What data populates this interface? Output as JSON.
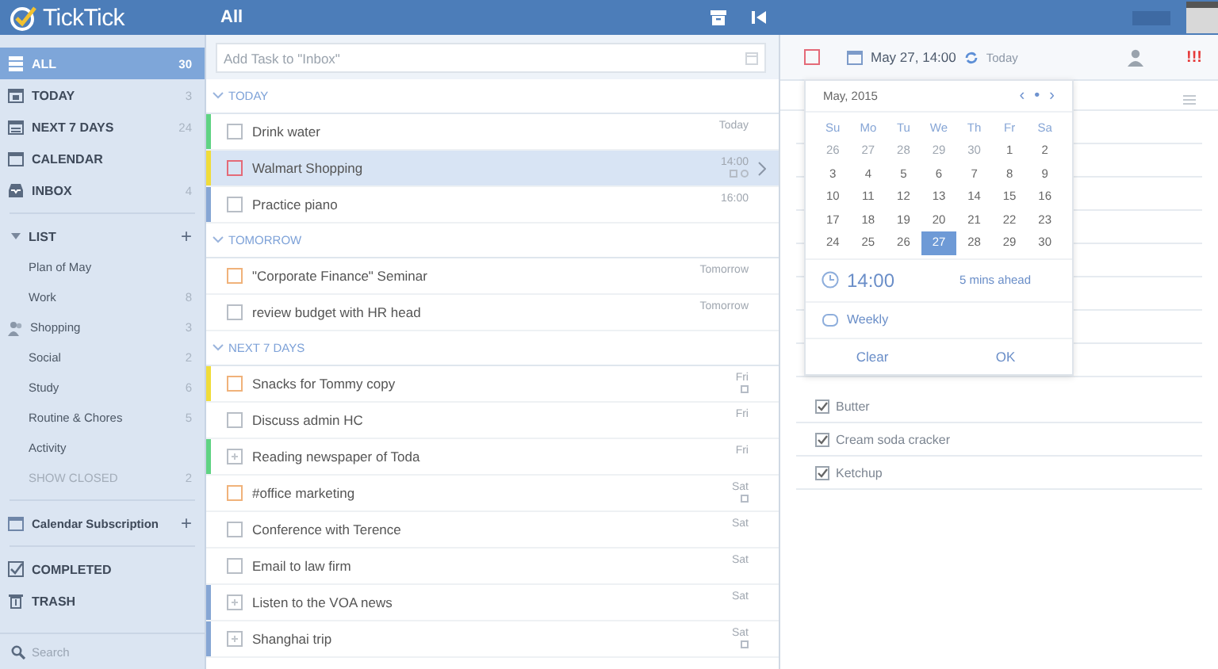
{
  "header": {
    "app_name": "TickTick",
    "title": "All"
  },
  "sidebar": {
    "smart_lists": [
      {
        "kind": "all",
        "label": "ALL",
        "count": "30",
        "selected": true
      },
      {
        "kind": "today",
        "label": "TODAY",
        "count": "3",
        "selected": false
      },
      {
        "kind": "week",
        "label": "NEXT 7 DAYS",
        "count": "24",
        "selected": false
      },
      {
        "kind": "calendar",
        "label": "CALENDAR",
        "selected": false
      },
      {
        "kind": "inbox",
        "label": "INBOX",
        "count": "4",
        "selected": false
      }
    ],
    "list_group": {
      "title": "LIST",
      "expanded": true,
      "add": "+"
    },
    "lists": [
      {
        "kind": "list",
        "label": "Plan of May"
      },
      {
        "kind": "list",
        "label": "Work",
        "count": "8"
      },
      {
        "kind": "shared",
        "label": "Shopping",
        "count": "3"
      },
      {
        "kind": "list",
        "label": "Social",
        "count": "2"
      },
      {
        "kind": "list",
        "label": "Study",
        "count": "6"
      },
      {
        "kind": "list",
        "label": "Routine & Chores",
        "count": "5"
      },
      {
        "kind": "list",
        "label": "Activity"
      },
      {
        "kind": "closed",
        "label": "SHOW CLOSED",
        "count": "2"
      }
    ],
    "calendar_subscription": {
      "label": "Calendar Subscription",
      "add": "+"
    },
    "bottom": [
      {
        "kind": "completed",
        "label": "COMPLETED"
      },
      {
        "kind": "trash",
        "label": "TRASH"
      }
    ],
    "search": {
      "placeholder": "Search"
    }
  },
  "list": {
    "add_placeholder": "Add Task to \"Inbox\"",
    "sections": [
      {
        "title": "TODAY",
        "expanded": true,
        "tasks": [
          {
            "title": "Drink water",
            "date": "Today",
            "kind": "task",
            "checkbox": {
              "color": "#b8bec6"
            },
            "color": "#5fd383",
            "selected": false,
            "extras": false
          },
          {
            "title": "Walmart Shopping",
            "date": "14:00",
            "kind": "task",
            "checkbox": {
              "color": "#e46a78"
            },
            "color": "#f0dc3a",
            "selected": true,
            "extras": true
          },
          {
            "title": "Practice piano",
            "date": "16:00",
            "kind": "task",
            "checkbox": {
              "color": "#b8bec6"
            },
            "color": "#86a6d4",
            "selected": false,
            "extras": false
          }
        ]
      },
      {
        "title": "TOMORROW",
        "expanded": true,
        "tasks": [
          {
            "title": "\"Corporate Finance\" Seminar",
            "date": "Tomorrow",
            "kind": "task",
            "checkbox": {
              "color": "#f0b27a"
            },
            "selected": false,
            "extras": false
          },
          {
            "title": "review budget with HR head",
            "date": "Tomorrow",
            "kind": "task",
            "checkbox": {
              "color": "#b8bec6"
            },
            "selected": false,
            "extras": false
          }
        ]
      },
      {
        "title": "NEXT 7 DAYS",
        "expanded": true,
        "tasks": [
          {
            "title": "Snacks for Tommy copy",
            "date": "Fri",
            "kind": "task",
            "checkbox": {
              "color": "#f0b27a"
            },
            "color": "#f0dc3a",
            "selected": false,
            "extras": true
          },
          {
            "title": "Discuss admin HC",
            "date": "Fri",
            "kind": "task",
            "checkbox": {
              "color": "#b8bec6"
            },
            "selected": false,
            "extras": false
          },
          {
            "title": "Reading newspaper of Toda",
            "date": "Fri",
            "kind": "checklist",
            "checkbox": {
              "color": "#b8bec6"
            },
            "color": "#5fd383",
            "selected": false,
            "extras": false
          },
          {
            "title": "#office marketing",
            "date": "Sat",
            "kind": "task",
            "checkbox": {
              "color": "#f0b27a"
            },
            "selected": false,
            "extras": true
          },
          {
            "title": "Conference with Terence",
            "date": "Sat",
            "kind": "task",
            "checkbox": {
              "color": "#b8bec6"
            },
            "selected": false,
            "extras": false
          },
          {
            "title": "Email to law firm",
            "date": "Sat",
            "kind": "task",
            "checkbox": {
              "color": "#b8bec6"
            },
            "selected": false,
            "extras": false
          },
          {
            "title": "Listen to the VOA news",
            "date": "Sat",
            "kind": "checklist",
            "checkbox": {
              "color": "#b8bec6"
            },
            "color": "#86a6d4",
            "selected": false,
            "extras": false
          },
          {
            "title": "Shanghai trip",
            "date": "Sat",
            "kind": "checklist",
            "checkbox": {
              "color": "#b8bec6"
            },
            "color": "#86a6d4",
            "selected": false,
            "extras": true
          }
        ]
      }
    ]
  },
  "detail": {
    "toolbar": {
      "checkbox": {
        "color": "#e46a78"
      },
      "date": "May 27, 14:00",
      "relative": "Today",
      "priority_mark": "!!!"
    },
    "items": [
      {
        "text": "Butter",
        "checked": true
      },
      {
        "text": "Cream soda cracker",
        "checked": true
      },
      {
        "text": "Ketchup",
        "checked": true
      }
    ]
  },
  "date_picker": {
    "month": "May, 2015",
    "nav": [
      "‹",
      "•",
      "›"
    ],
    "weekdays": [
      "Su",
      "Mo",
      "Tu",
      "We",
      "Th",
      "Fr",
      "Sa"
    ],
    "days": [
      {
        "label": "26",
        "muted": true,
        "selected": false
      },
      {
        "label": "27",
        "muted": true,
        "selected": false
      },
      {
        "label": "28",
        "muted": true,
        "selected": false
      },
      {
        "label": "29",
        "muted": true,
        "selected": false
      },
      {
        "label": "30",
        "muted": true,
        "selected": false
      },
      {
        "label": "1",
        "muted": false,
        "selected": false
      },
      {
        "label": "2",
        "muted": false,
        "selected": false
      },
      {
        "label": "3",
        "muted": false,
        "selected": false
      },
      {
        "label": "4",
        "muted": false,
        "selected": false
      },
      {
        "label": "5",
        "muted": false,
        "selected": false
      },
      {
        "label": "6",
        "muted": false,
        "selected": false
      },
      {
        "label": "7",
        "muted": false,
        "selected": false
      },
      {
        "label": "8",
        "muted": false,
        "selected": false
      },
      {
        "label": "9",
        "muted": false,
        "selected": false
      },
      {
        "label": "10",
        "muted": false,
        "selected": false
      },
      {
        "label": "11",
        "muted": false,
        "selected": false
      },
      {
        "label": "12",
        "muted": false,
        "selected": false
      },
      {
        "label": "13",
        "muted": false,
        "selected": false
      },
      {
        "label": "14",
        "muted": false,
        "selected": false
      },
      {
        "label": "15",
        "muted": false,
        "selected": false
      },
      {
        "label": "16",
        "muted": false,
        "selected": false
      },
      {
        "label": "17",
        "muted": false,
        "selected": false
      },
      {
        "label": "18",
        "muted": false,
        "selected": false
      },
      {
        "label": "19",
        "muted": false,
        "selected": false
      },
      {
        "label": "20",
        "muted": false,
        "selected": false
      },
      {
        "label": "21",
        "muted": false,
        "selected": false
      },
      {
        "label": "22",
        "muted": false,
        "selected": false
      },
      {
        "label": "23",
        "muted": false,
        "selected": false
      },
      {
        "label": "24",
        "muted": false,
        "selected": false
      },
      {
        "label": "25",
        "muted": false,
        "selected": false
      },
      {
        "label": "26",
        "muted": false,
        "selected": false
      },
      {
        "label": "27",
        "muted": false,
        "selected": true
      },
      {
        "label": "28",
        "muted": false,
        "selected": false
      },
      {
        "label": "29",
        "muted": false,
        "selected": false
      },
      {
        "label": "30",
        "muted": false,
        "selected": false
      }
    ],
    "time": "14:00",
    "reminder": "5 mins ahead",
    "repeat": "Weekly",
    "buttons": [
      "Clear",
      "OK"
    ]
  }
}
